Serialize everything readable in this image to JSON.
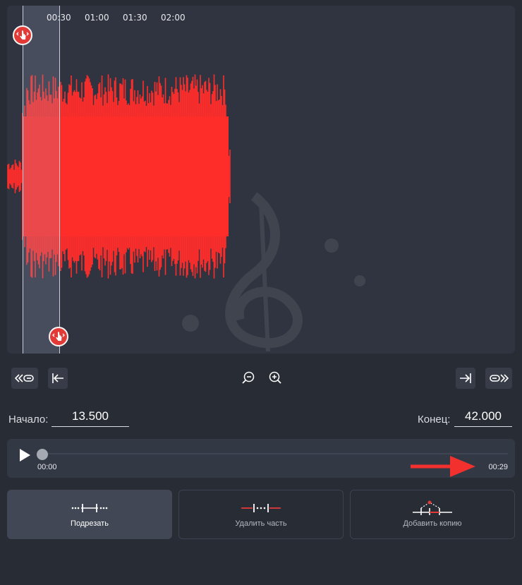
{
  "timeline": {
    "ticks": [
      "00:30",
      "01:00",
      "01:30",
      "02:00"
    ]
  },
  "controls": {
    "skip_start_icon": "rewind-to-start-icon",
    "set_start_icon": "set-start-marker-icon",
    "zoom_out_icon": "zoom-out-icon",
    "zoom_in_icon": "zoom-in-icon",
    "set_end_icon": "set-end-marker-icon",
    "skip_end_icon": "forward-to-end-icon"
  },
  "range": {
    "start_label": "Начало:",
    "start_value": "13.500",
    "end_label": "Конец:",
    "end_value": "42.000"
  },
  "player": {
    "current_time": "00:00",
    "total_time": "00:29",
    "progress": 0
  },
  "modes": [
    {
      "label": "Подрезать",
      "active": true
    },
    {
      "label": "Удалить часть",
      "active": false
    },
    {
      "label": "Добавить копию",
      "active": false
    }
  ],
  "colors": {
    "waveform": "#ff2d2a",
    "background": "#282c35",
    "panel": "#2f3440",
    "accent": "#e23a36"
  }
}
